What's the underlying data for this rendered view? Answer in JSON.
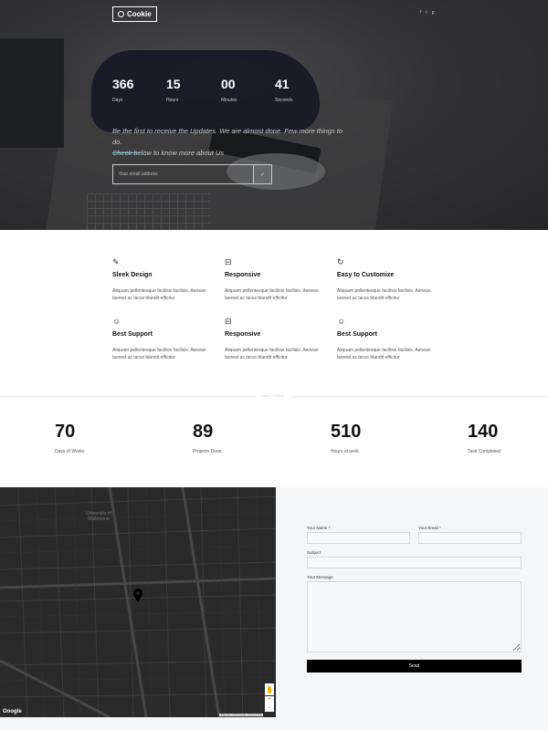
{
  "brand": {
    "name": "Cookie"
  },
  "header": {
    "social": [
      "f",
      "t",
      "p"
    ]
  },
  "countdown": [
    {
      "value": "366",
      "label": "Days"
    },
    {
      "value": "15",
      "label": "Hours"
    },
    {
      "value": "00",
      "label": "Minutes"
    },
    {
      "value": "41",
      "label": "Seconds"
    }
  ],
  "intro": {
    "line1": "Be the first to receive the Updates. We are almost done. Few more things to do.",
    "line2": "Check below to know more about Us"
  },
  "subscribe": {
    "placeholder": "Your email address",
    "submit_icon": "✓"
  },
  "features": [
    {
      "icon": "pencil-icon",
      "glyph": "✎",
      "title": "Sleek Design",
      "text": "Aliquam pellentesque facilisis facilisis. Aenean laoreet ac lacus blandit efficitur"
    },
    {
      "icon": "paint-roller-icon",
      "glyph": "⊟",
      "title": "Responsive",
      "text": "Aliquam pellentesque facilisis facilisis. Aenean laoreet ac lacus blandit efficitur"
    },
    {
      "icon": "refresh-icon",
      "glyph": "↻",
      "title": "Easy to Customize",
      "text": "Aliquam pellentesque facilisis facilisis. Aenean laoreet ac lacus blandit efficitur"
    },
    {
      "icon": "smiley-icon",
      "glyph": "☺",
      "title": "Best Support",
      "text": "Aliquam pellentesque facilisis facilisis. Aenean laoreet ac lacus blandit efficitur"
    },
    {
      "icon": "paint-roller-icon",
      "glyph": "⊟",
      "title": "Responsive",
      "text": "Aliquam pellentesque facilisis facilisis. Aenean laoreet ac lacus blandit efficitur"
    },
    {
      "icon": "smiley-icon",
      "glyph": "☺",
      "title": "Best Support",
      "text": "Aliquam pellentesque facilisis facilisis. Aenean laoreet ac lacus blandit efficitur"
    }
  ],
  "divider": {
    "label": "Keep in Touch"
  },
  "stats": [
    {
      "value": "70",
      "label": "Days of Works"
    },
    {
      "value": "89",
      "label": "Projects Done"
    },
    {
      "value": "510",
      "label": "Hours of work"
    },
    {
      "value": "140",
      "label": "Task Completed"
    }
  ],
  "map": {
    "provider": "Google",
    "place_label": "University of Melbourne",
    "attribution": "Map data ©2018 Google | Terms of Use",
    "zoom_in": "+",
    "zoom_out": "−"
  },
  "contact": {
    "name_label": "Your Name *",
    "email_label": "Your Email *",
    "subject_label": "Subject",
    "message_label": "Your Message",
    "send_label": "Send"
  },
  "colors": {
    "accent": "#6ab7c9",
    "button": "#000000"
  }
}
